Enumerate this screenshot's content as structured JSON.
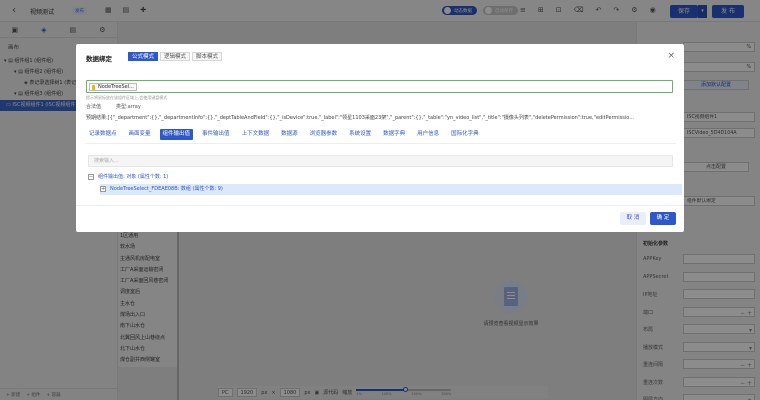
{
  "app": {
    "title": "视频测试",
    "badge": "发布",
    "toggle_on": "动态数据",
    "toggle_off": "自动保存",
    "save_label": "保存",
    "publish_label": "发 布"
  },
  "left_panel": {
    "section_label": "画布",
    "tree": [
      {
        "label": "▾ ▤ 组件组1 (组件组)",
        "indent": 4,
        "selected": false
      },
      {
        "label": "▾ ▤ 组件组2 (组件组)",
        "indent": 14,
        "selected": false
      },
      {
        "label": "◈ 表记录选择树1 (表记录选择树)",
        "indent": 24,
        "selected": false
      },
      {
        "label": "▾ ▤ 组件组3 (组件组)",
        "indent": 14,
        "selected": false
      },
      {
        "label": "▭ ISC视频组件1 (ISC视频组件)",
        "indent": 6,
        "selected": true
      }
    ],
    "footer": [
      "+ 新建",
      "+ 组件",
      "+ 容器"
    ]
  },
  "canvas": {
    "list_items": [
      "1区通用",
      "软水场",
      "主通风机房配电室",
      "工厂A采面运输密闭",
      "工厂A采面回风巷密闭",
      "调度室后",
      "主水仓",
      "煤场出入口",
      "南下山水仓",
      "北翼回风上山巷绕点",
      "北下山水仓",
      "煤仓副井西侧罐室"
    ],
    "placeholder_text": "请预览查看视频显示效果",
    "bottom": {
      "device": "PC",
      "width": "1920",
      "unit_w": "px",
      "height": "1080",
      "unit_h": "px",
      "source_label": "源代码",
      "zoom_label": "缩放",
      "zoom_ticks": [
        "1%",
        "100%",
        "200%",
        "300%"
      ],
      "zoom_value": 0.52
    }
  },
  "right_panel": {
    "row1": "%",
    "row2": "%",
    "tag_button": "添加默认配置",
    "name_value": "ISC视频组件1",
    "id_value": "ISCVideo_5D4D104A",
    "add_config": "点击配置",
    "row_select": "组件默认绑定",
    "section": "初始化参数",
    "params": [
      "APPKey",
      "APPSecret",
      "IP地址",
      "端口",
      "布局",
      "播放模式",
      "重连间隔",
      "重连次数",
      "图层方向"
    ]
  },
  "dialog": {
    "title": "数据绑定",
    "mode_tabs": [
      "公式模式",
      "逻辑模式",
      "脚本模式"
    ],
    "active_mode": 0,
    "close_icon": "×",
    "token": "NodeTreeSel...",
    "hint": "提示将鼠标放在该组件区域上,会使用键盘模式",
    "valid_label": "合法值",
    "type_label": "类型:array",
    "preview": "预期结果:[{\"_department\":{},\"_departmentInfo\":{},\"_deptTableAndField\":{},\"_isDevice\":true,\"_label\":\"领星1103采面23架\",\"_parent\":{},\"_table\":\"yn_video_list\",\"_title\":\"摄像头列表\",\"deletePermission\":true,\"editPermissio...",
    "var_tabs": [
      "记录数据点",
      "画面变量",
      "组件输出值",
      "事件输出值",
      "上下文数据",
      "数据源",
      "浏览器参数",
      "系统设置",
      "数据字典",
      "用户信息",
      "国际化字典"
    ],
    "active_var": 2,
    "search_placeholder": "搜索输入...",
    "tree_root": "组件输出值:  对象 (属性个数: 1)",
    "tree_child": "NodeTreeSelect_FDEAE08B: 数组 (属性个数: 9)",
    "cancel_label": "取 消",
    "ok_label": "确 定"
  }
}
